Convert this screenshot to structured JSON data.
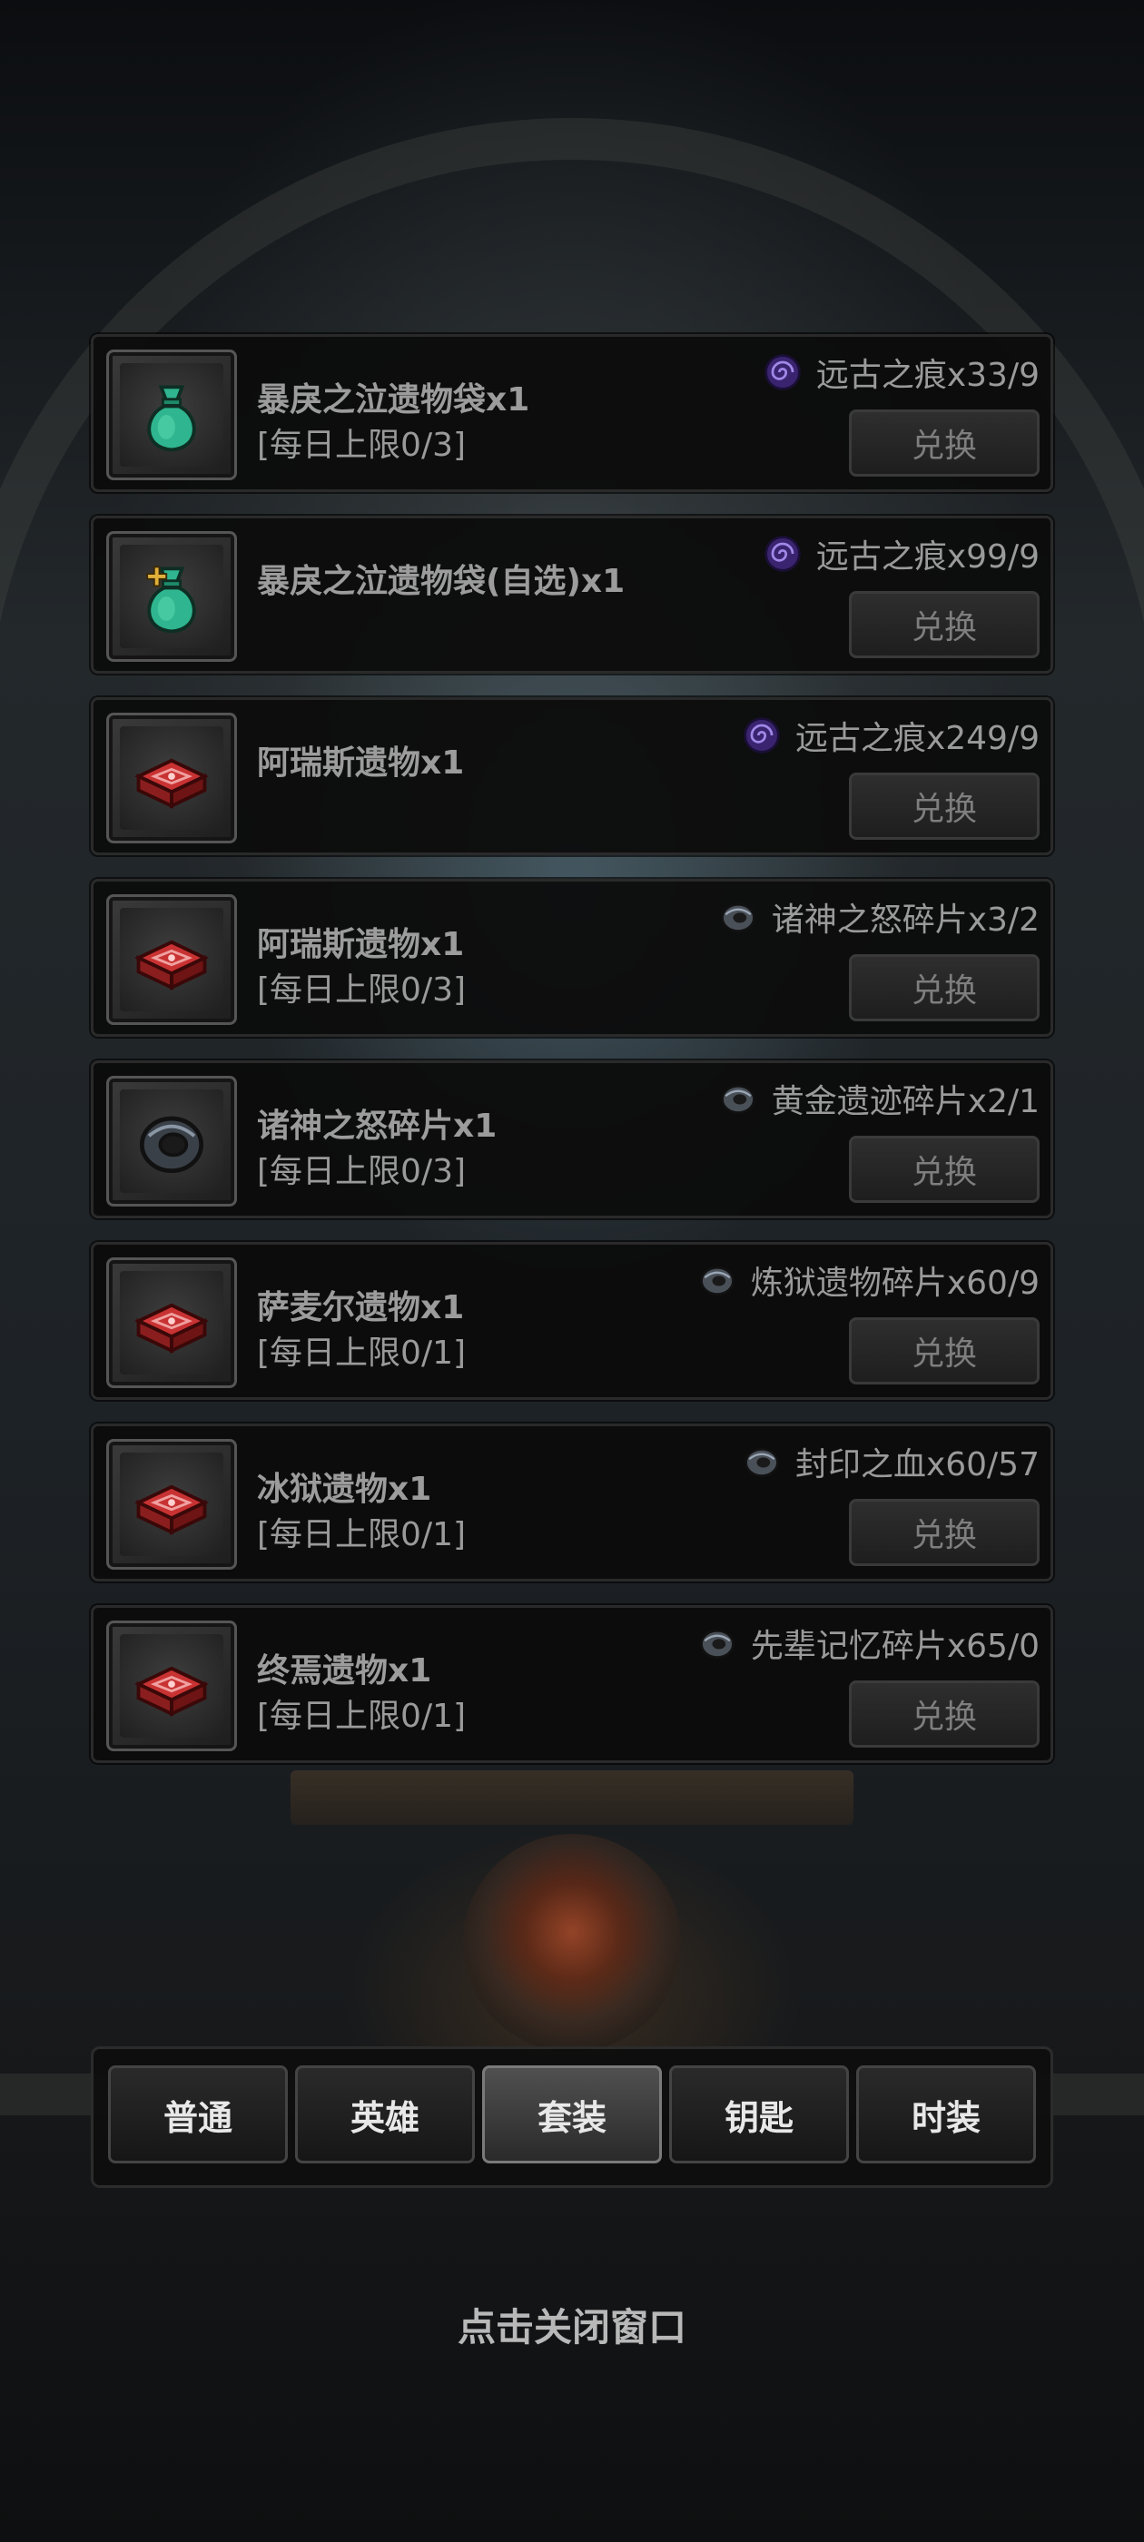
{
  "rows": [
    {
      "name": "暴戾之泣遗物袋x1",
      "limit": "[每日上限0/3]",
      "cost_icon": "swirl-icon",
      "cost": "远古之痕x33/9",
      "button": "兑换",
      "item_icon": "green-bag-icon"
    },
    {
      "name": "暴戾之泣遗物袋(自选)x1",
      "limit": "",
      "cost_icon": "swirl-icon",
      "cost": "远古之痕x99/9",
      "button": "兑换",
      "item_icon": "green-bag-plus-icon"
    },
    {
      "name": "阿瑞斯遗物x1",
      "limit": "",
      "cost_icon": "swirl-icon",
      "cost": "远古之痕x249/9",
      "button": "兑换",
      "item_icon": "red-box-icon"
    },
    {
      "name": "阿瑞斯遗物x1",
      "limit": "[每日上限0/3]",
      "cost_icon": "ring-fragment-icon",
      "cost": "诸神之怒碎片x3/2",
      "button": "兑换",
      "item_icon": "red-box-icon"
    },
    {
      "name": "诸神之怒碎片x1",
      "limit": "[每日上限0/3]",
      "cost_icon": "ring-fragment-icon",
      "cost": "黄金遗迹碎片x2/1",
      "button": "兑换",
      "item_icon": "ring-icon"
    },
    {
      "name": "萨麦尔遗物x1",
      "limit": "[每日上限0/1]",
      "cost_icon": "ring-fragment-icon",
      "cost": "炼狱遗物碎片x60/9",
      "button": "兑换",
      "item_icon": "red-box-icon"
    },
    {
      "name": "冰狱遗物x1",
      "limit": "[每日上限0/1]",
      "cost_icon": "ring-fragment-icon",
      "cost": "封印之血x60/57",
      "button": "兑换",
      "item_icon": "red-box-icon"
    },
    {
      "name": "终焉遗物x1",
      "limit": "[每日上限0/1]",
      "cost_icon": "ring-fragment-icon",
      "cost": "先辈记忆碎片x65/0",
      "button": "兑换",
      "item_icon": "red-box-icon"
    }
  ],
  "tabs": [
    {
      "label": "普通",
      "active": false
    },
    {
      "label": "英雄",
      "active": false
    },
    {
      "label": "套装",
      "active": true
    },
    {
      "label": "钥匙",
      "active": false
    },
    {
      "label": "时装",
      "active": false
    }
  ],
  "close_hint": "点击关闭窗口",
  "colors": {
    "panel": "#0c0c0c",
    "text": "#9c9c9c",
    "tab_text": "#e8e8e8",
    "swirl": "#6b4bb8",
    "bag": "#2fb58f",
    "box": "#b5262a"
  }
}
